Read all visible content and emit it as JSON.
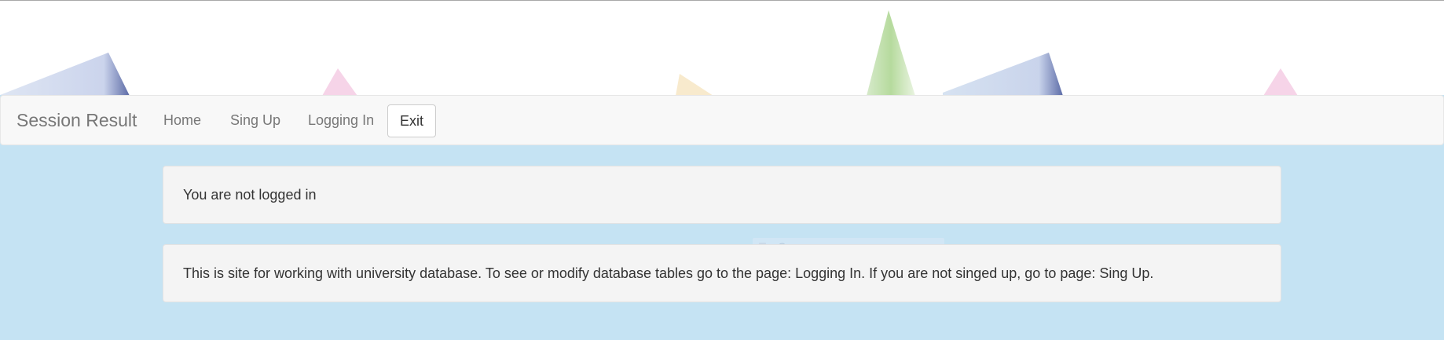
{
  "navbar": {
    "brand": "Session Result",
    "links": [
      "Home",
      "Sing Up",
      "Logging In"
    ],
    "exit_label": "Exit"
  },
  "status_message": "You are not logged in",
  "info_message": "This is site for working with university database. To see or modify database tables go to the page: Logging In. If you are not singed up, go to page: Sing Up.",
  "overlay_hint": "Окно"
}
